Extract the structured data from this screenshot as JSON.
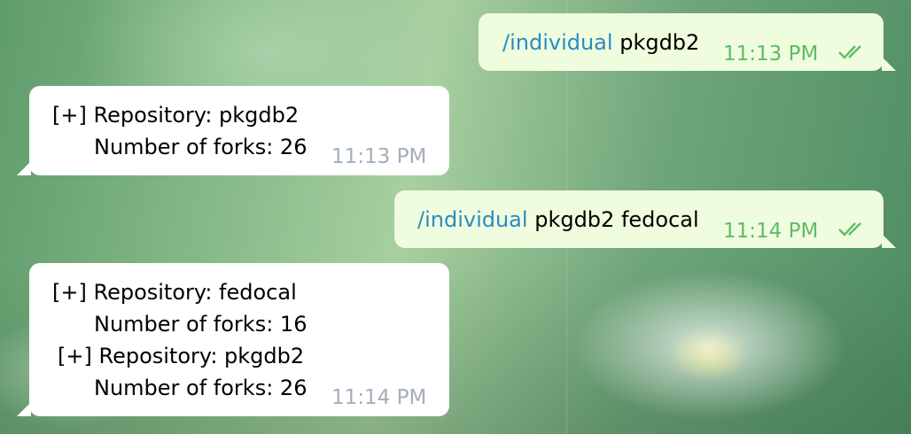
{
  "messages": [
    {
      "id": "m1",
      "direction": "outgoing",
      "command": "/individual",
      "args": "pkgdb2",
      "time": "11:13 PM",
      "status": "read-double-check-icon"
    },
    {
      "id": "m2",
      "direction": "incoming",
      "lines": [
        "[+] Repository: pkgdb2",
        "Number of forks: 26"
      ],
      "time": "11:13 PM"
    },
    {
      "id": "m3",
      "direction": "outgoing",
      "command": "/individual",
      "args": "pkgdb2 fedocal",
      "time": "11:14 PM",
      "status": "read-double-check-icon"
    },
    {
      "id": "m4",
      "direction": "incoming",
      "lines": [
        "[+] Repository: fedocal",
        "Number of forks: 16",
        "[+] Repository: pkgdb2",
        "Number of forks: 26"
      ],
      "time": "11:14 PM"
    }
  ],
  "colors": {
    "incoming_bubble": "#ffffff",
    "outgoing_bubble": "#effdde",
    "command_link": "#2a8bc4",
    "outgoing_time": "#5fbc65",
    "incoming_time": "#a4aeb8"
  }
}
